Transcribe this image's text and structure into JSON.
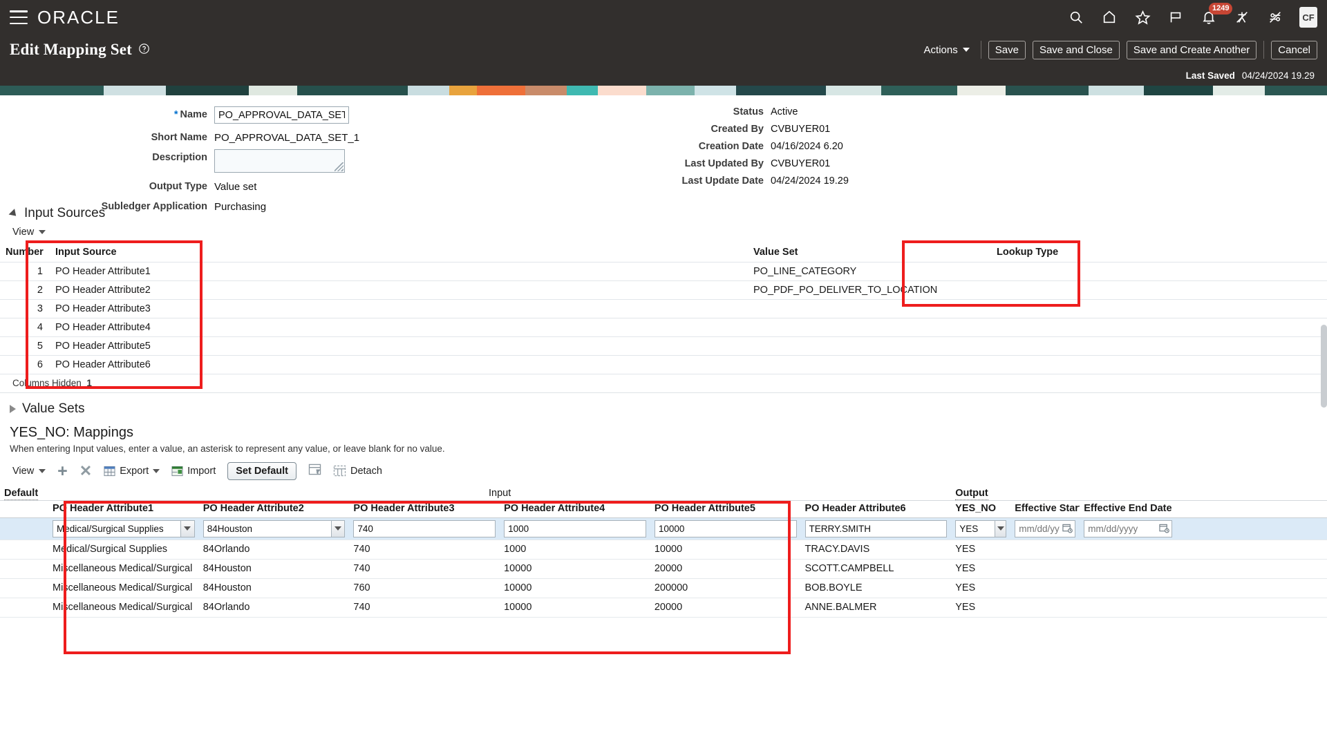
{
  "header": {
    "logo": "ORACLE",
    "icons": [
      "menu-icon",
      "search-icon",
      "home-icon",
      "favorites-icon",
      "flag-icon",
      "notifications-icon",
      "accessibility-icon",
      "settings-icon"
    ],
    "notification_count": "1249",
    "avatar_initials": "CF"
  },
  "title_bar": {
    "title": "Edit Mapping Set",
    "actions_label": "Actions",
    "buttons": [
      {
        "label": "Save",
        "accesskey": "S"
      },
      {
        "label": "Save and Close",
        "accesskey": "S"
      },
      {
        "label": "Save and Create Another",
        "accesskey": ""
      },
      {
        "label": "Cancel",
        "accesskey": "C"
      }
    ]
  },
  "saved": {
    "label": "Last Saved",
    "value": "04/24/2024 19.29"
  },
  "summary": {
    "left_fields": [
      {
        "label": "Name",
        "value": "PO_APPROVAL_DATA_SET_1",
        "required": true,
        "type": "input"
      },
      {
        "label": "Short Name",
        "value": "PO_APPROVAL_DATA_SET_1",
        "required": false,
        "type": "text"
      },
      {
        "label": "Description",
        "value": "",
        "required": false,
        "type": "textarea"
      },
      {
        "label": "Output Type",
        "value": "Value set",
        "required": false,
        "type": "text"
      },
      {
        "label": "Subledger Application",
        "value": "Purchasing",
        "required": false,
        "type": "text"
      }
    ],
    "right_fields": [
      {
        "label": "Status",
        "value": "Active"
      },
      {
        "label": "Created By",
        "value": "CVBUYER01"
      },
      {
        "label": "Creation Date",
        "value": "04/16/2024 6.20"
      },
      {
        "label": "Last Updated By",
        "value": "CVBUYER01"
      },
      {
        "label": "Last Update Date",
        "value": "04/24/2024 19.29"
      }
    ]
  },
  "input_sources": {
    "section_title": "Input Sources",
    "view_label": "View",
    "columns": [
      "Number",
      "Input Source",
      "",
      "Value Set",
      "Lookup Type"
    ],
    "rows": [
      {
        "number": "1",
        "source": "PO Header Attribute1",
        "value_set": "PO_LINE_CATEGORY",
        "lookup_type": ""
      },
      {
        "number": "2",
        "source": "PO Header Attribute2",
        "value_set": "PO_PDF_PO_DELIVER_TO_LOCATION",
        "lookup_type": ""
      },
      {
        "number": "3",
        "source": "PO Header Attribute3",
        "value_set": "",
        "lookup_type": ""
      },
      {
        "number": "4",
        "source": "PO Header Attribute4",
        "value_set": "",
        "lookup_type": ""
      },
      {
        "number": "5",
        "source": "PO Header Attribute5",
        "value_set": "",
        "lookup_type": ""
      },
      {
        "number": "6",
        "source": "PO Header Attribute6",
        "value_set": "",
        "lookup_type": ""
      }
    ],
    "columns_hidden_label": "Columns Hidden",
    "columns_hidden_count": "1"
  },
  "value_sets": {
    "section_title": "Value Sets"
  },
  "mappings": {
    "heading": "YES_NO: Mappings",
    "note": "When entering Input values, enter a value, an asterisk to represent any value, or leave blank for no value.",
    "toolbar": {
      "view_label": "View",
      "add_label": "+",
      "delete_label": "✕",
      "export_label": "Export",
      "import_label": "Import",
      "set_default_label": "Set Default",
      "freeze_icon": "freeze-icon",
      "detach_label": "Detach"
    },
    "group_headers": {
      "default": "Default",
      "input": "Input",
      "output": "Output"
    },
    "columns": [
      "PO Header Attribute1",
      "PO Header Attribute2",
      "PO Header Attribute3",
      "PO Header Attribute4",
      "PO Header Attribute5",
      "PO Header Attribute6",
      "YES_NO",
      "Effective Start Date",
      "Effective End Date"
    ],
    "date_placeholder": "mm/dd/yyyy",
    "edit_row": {
      "a1": "Medical/Surgical Supplies",
      "a2": "84Houston",
      "a3": "740",
      "a4": "1000",
      "a5": "10000",
      "a6": "TERRY.SMITH",
      "out": "YES",
      "start": "",
      "end": ""
    },
    "rows": [
      {
        "a1": "Medical/Surgical Supplies",
        "a2": "84Orlando",
        "a3": "740",
        "a4": "1000",
        "a5": "10000",
        "a6": "TRACY.DAVIS",
        "out": "YES",
        "start": "",
        "end": ""
      },
      {
        "a1": "Miscellaneous Medical/Surgical",
        "a2": "84Houston",
        "a3": "740",
        "a4": "10000",
        "a5": "20000",
        "a6": "SCOTT.CAMPBELL",
        "out": "YES",
        "start": "",
        "end": ""
      },
      {
        "a1": "Miscellaneous Medical/Surgical",
        "a2": "84Houston",
        "a3": "760",
        "a4": "10000",
        "a5": "200000",
        "a6": "BOB.BOYLE",
        "out": "YES",
        "start": "",
        "end": ""
      },
      {
        "a1": "Miscellaneous Medical/Surgical",
        "a2": "84Orlando",
        "a3": "740",
        "a4": "10000",
        "a5": "20000",
        "a6": "ANNE.BALMER",
        "out": "YES",
        "start": "",
        "end": ""
      }
    ]
  },
  "annotations": {
    "highlight_color": "#ee1d1d",
    "boxes": [
      "input-source-columns",
      "value-set-column",
      "mapping-input-columns"
    ]
  }
}
